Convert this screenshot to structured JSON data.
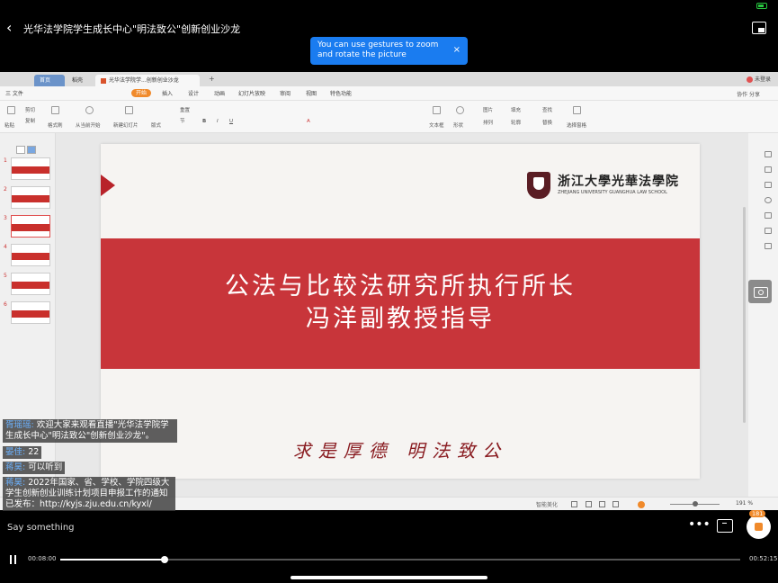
{
  "header": {
    "title": "光华法学院学生成长中心\"明法致公\"创新创业沙龙",
    "toast": "You can use gestures to zoom and rotate the picture",
    "toast_close": "×"
  },
  "app": {
    "tabs": [
      "首页",
      "稻壳",
      "光华法学院学...创新创业沙龙"
    ],
    "user": "未登录",
    "menus": [
      "三 文件",
      "开始",
      "插入",
      "设计",
      "动画",
      "幻灯片放映",
      "审阅",
      "视图",
      "特色功能"
    ],
    "active_menu": "开始",
    "right_tools": "协作  分享",
    "ribbon": {
      "paste": "粘贴",
      "cut": "剪切",
      "copy": "复制",
      "format_painter": "格式刷",
      "play_from_current": "从当前开始",
      "new_slide": "新建幻灯片",
      "layout": "版式",
      "section": "节",
      "reset": "重置",
      "textbox": "文本框",
      "shape": "形状",
      "picture": "图片",
      "fill": "填充",
      "find": "查找",
      "arrange": "排列",
      "outline": "轮廓",
      "replace": "替换",
      "select_pane": "选择窗格"
    },
    "thumbnails": [
      "1",
      "2",
      "3",
      "4",
      "5",
      "6"
    ],
    "active_thumbnail": 3,
    "slide": {
      "logo_cn": "浙江大學光華法學院",
      "logo_en": "ZHEJIANG UNIVERSITY GUANGHUA LAW SCHOOL",
      "line1": "公法与比较法研究所执行所长",
      "line2": "冯洋副教授指导",
      "motto": "求是厚德 明法致公"
    },
    "status": {
      "smart_beautify": "智能美化",
      "zoom": "191 %",
      "zoom_level": 0.5
    }
  },
  "chat": [
    {
      "name": "胥瑶瑶:",
      "text": " 欢迎大家来观看直播\"光华法学院学生成长中心\"明法致公\"创新创业沙龙\"。"
    },
    {
      "name": "晏佳:",
      "text": " 22"
    },
    {
      "name": "蒋昊:",
      "text": " 可以听到"
    },
    {
      "name": "蒋昊:",
      "text": " 2022年国家、省、学校、学院四级大学生创新创业训练计划项目申报工作的通知已发布：http://kyjs.zju.edu.cn/kyxl/"
    }
  ],
  "controls": {
    "say_placeholder": "Say something",
    "more": "•••",
    "like_count": "181",
    "current_time": "00:08:00",
    "total_time": "00:52:15",
    "progress": 0.153
  }
}
